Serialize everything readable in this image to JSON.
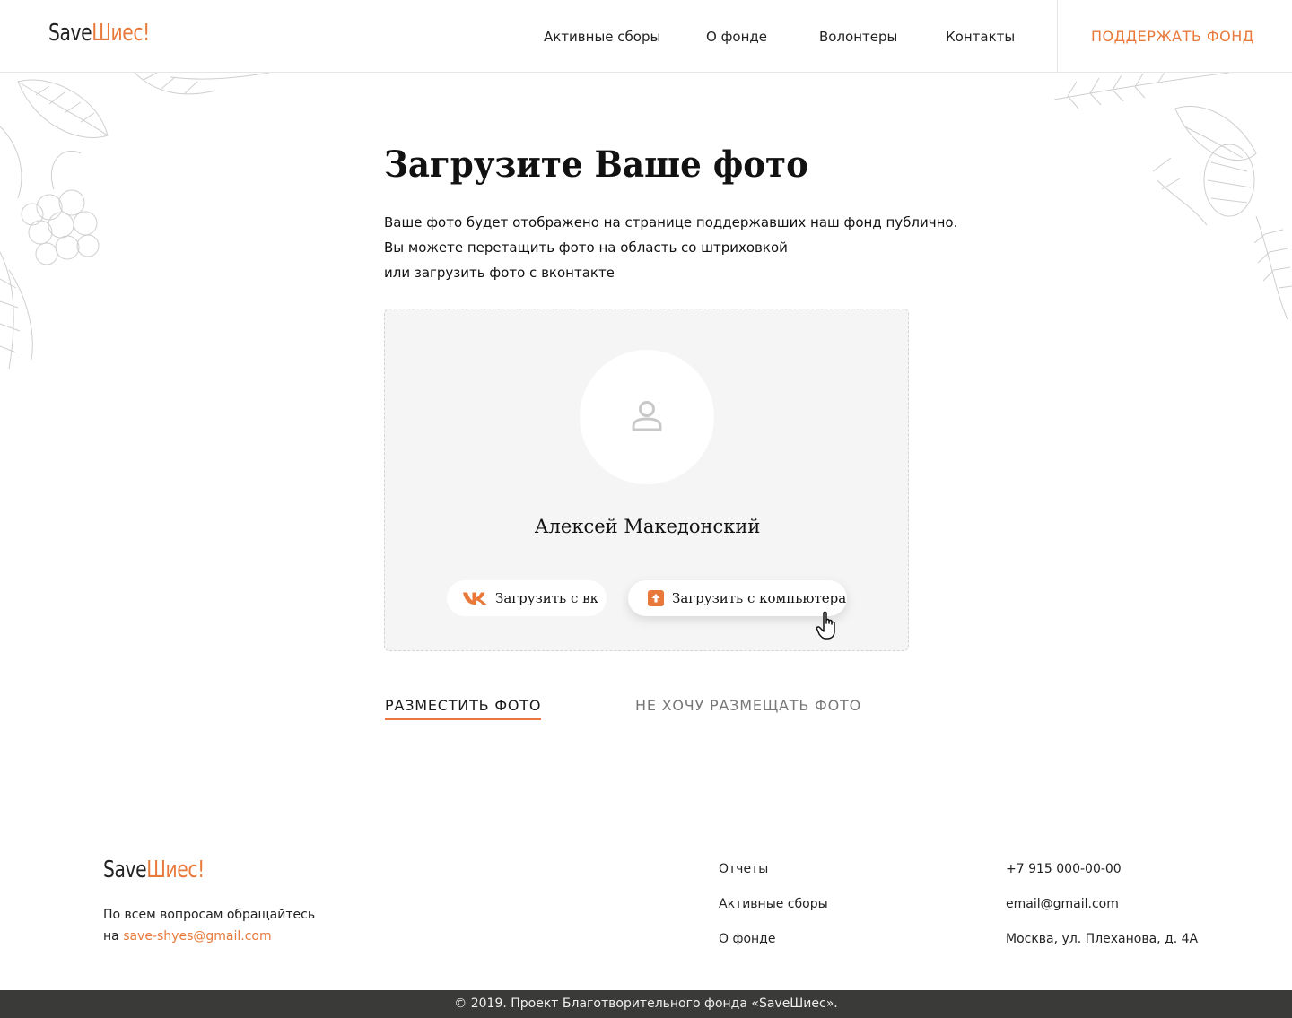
{
  "brand": {
    "logo_part1": "Save",
    "logo_part2": "Шиес!"
  },
  "header": {
    "nav": [
      "Активные сборы",
      "О фонде",
      "Волонтеры",
      "Контакты"
    ],
    "support_label": "ПОДДЕРЖАТЬ ФОНД"
  },
  "main": {
    "title": "Загрузите Ваше фото",
    "description": [
      "Ваше фото будет отображено на странице поддержавших наш фонд публично.",
      "Вы можете перетащить фото на область со штриховкой",
      "или загрузить фото с вконтакте"
    ],
    "upload": {
      "user_name": "Алексей Македонский",
      "vk_button": "Загрузить с вк",
      "pc_button": "Загрузить с компьютера"
    },
    "actions": {
      "place_photo": "РАЗМЕСТИТЬ ФОТО",
      "skip_photo": "НЕ ХОЧУ РАЗМЕЩАТЬ ФОТО"
    }
  },
  "footer": {
    "contact_text_line1": "По всем вопросам обращайтесь",
    "contact_text_prefix": "на",
    "contact_email": "save-shyes@gmail.com",
    "links": [
      "Отчеты",
      "Активные сборы",
      "О фонде"
    ],
    "phone": "+7 915 000-00-00",
    "email": "email@gmail.com",
    "address": "Москва, ул. Плеханова, д. 4А",
    "copyright": "© 2019. Проект Благотворительного фонда «SaveШиес»."
  },
  "colors": {
    "accent": "#e8793a",
    "footer_bar": "#3a3a38",
    "dropzone_bg": "#f5f5f5"
  },
  "icons": [
    "user-silhouette-icon",
    "vk-icon",
    "upload-icon",
    "hand-cursor-icon"
  ]
}
